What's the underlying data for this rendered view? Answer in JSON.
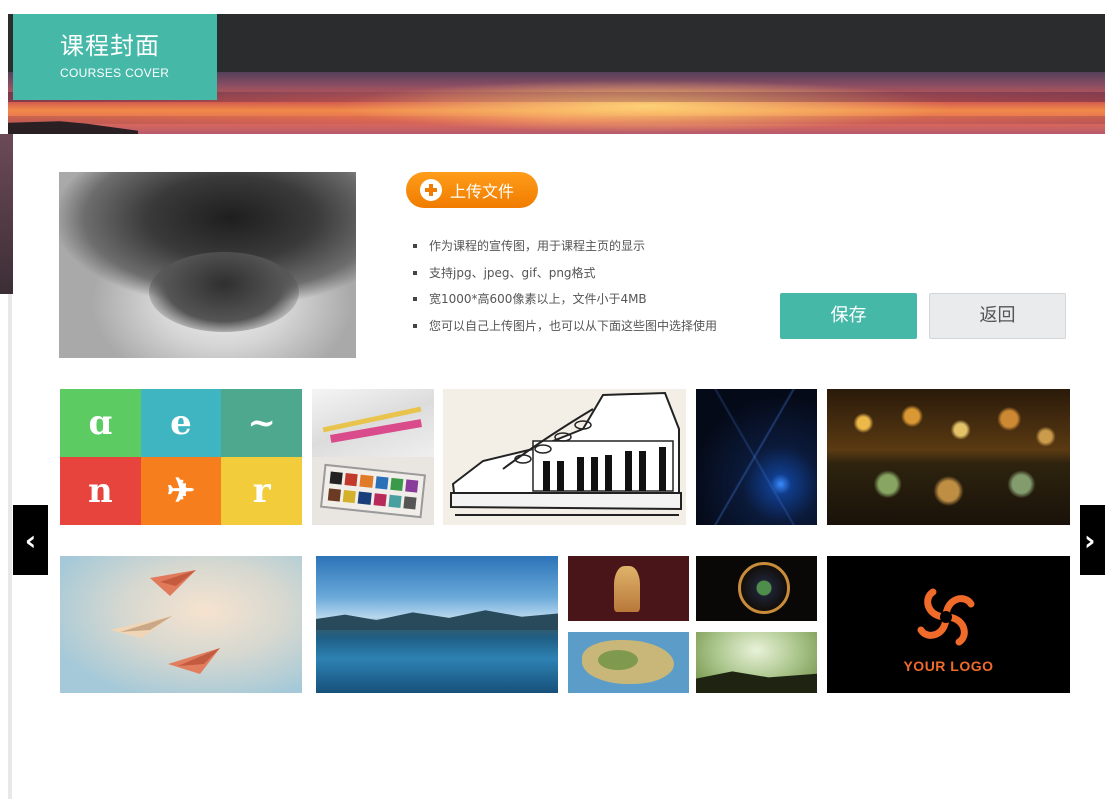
{
  "header": {
    "title": "课程封面",
    "subtitle": "COURSES COVER",
    "accent_color": "#46b8a8"
  },
  "upload": {
    "label": "上传文件",
    "icon": "plus-circle-icon",
    "color": "#f07c00"
  },
  "tips": [
    "作为课程的宣传图，用于课程主页的显示",
    "支持jpg、jpeg、gif、png格式",
    "宽1000*高600像素以上，文件小于4MB",
    "您可以自己上传图片，也可以从下面这些图中选择使用"
  ],
  "actions": {
    "save_label": "保存",
    "back_label": "返回"
  },
  "gallery": {
    "prev_label": "‹",
    "next_label": "›",
    "logo_tile_text": "YOUR LOGO",
    "logo_grid": [
      {
        "glyph": "ɑ",
        "color": "#5ccc62"
      },
      {
        "glyph": "e",
        "color": "#3fb5c1"
      },
      {
        "glyph": "~",
        "color": "#4ea88e"
      },
      {
        "glyph": "n",
        "color": "#e6443c"
      },
      {
        "glyph": "✈",
        "color": "#f77e1c"
      },
      {
        "glyph": "r",
        "color": "#f3cc3b"
      }
    ]
  }
}
